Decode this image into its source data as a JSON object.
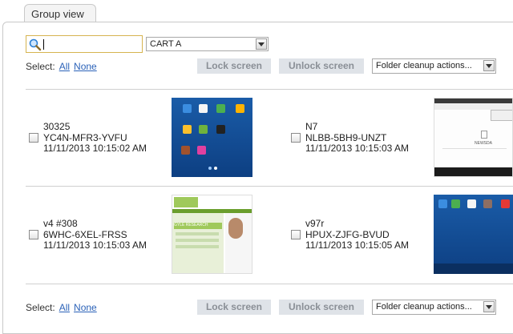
{
  "tab": {
    "label": "Group view"
  },
  "toolbar": {
    "search_value": "",
    "cart_select": "CART A",
    "select_label": "Select:",
    "all_label": "All",
    "none_label": "None",
    "lock_label": "Lock screen",
    "unlock_label": "Unlock screen",
    "folder_select": "Folder cleanup actions..."
  },
  "devices": [
    {
      "name": "30325",
      "code": "YC4N-MFR3-YVFU",
      "time": "11/11/2013 10:15:02 AM"
    },
    {
      "name": "N7",
      "code": "NLBB-5BH9-UNZT",
      "time": "11/11/2013 10:15:03 AM",
      "thumb_text": "NEWSDA"
    },
    {
      "name": "v4 #308",
      "code": "6WHC-6XEL-FRSS",
      "time": "11/11/2013 10:15:03 AM",
      "thumb_text": "GYLE RESEARCH"
    },
    {
      "name": "v97r",
      "code": "HPUX-ZJFG-BVUD",
      "time": "11/11/2013 10:15:05 AM"
    }
  ],
  "colors": {
    "link": "#2b62b8",
    "disabled_button_bg": "#dfe3e8",
    "disabled_button_text": "#8a8f96"
  }
}
